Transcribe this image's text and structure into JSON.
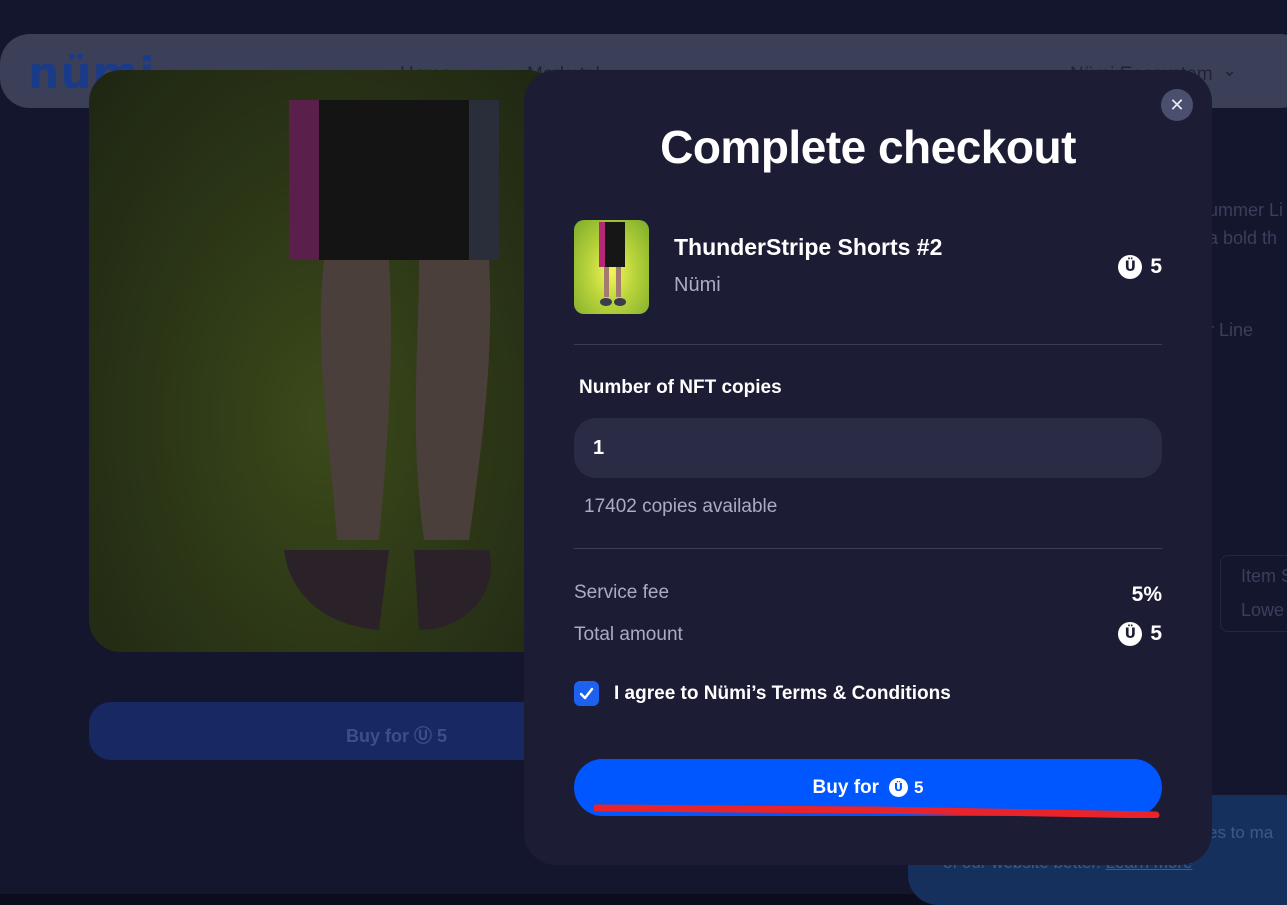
{
  "background": {
    "logo": "nümi",
    "nav": {
      "home": "Home",
      "marketplace": "Marketpl",
      "ecosystem": "Nümi Ecosystem"
    },
    "buy_button": {
      "label": "Buy for",
      "amount": "5"
    },
    "right_text": {
      "line1": "ummer Li",
      "line2": "a bold th",
      "line3": "r Line",
      "card_line1": "Item S",
      "card_line2": "Lowe"
    },
    "cookie": {
      "line1": "es to ma",
      "line2": "of our website better.",
      "link": "Learn more"
    }
  },
  "modal": {
    "title": "Complete checkout",
    "close_icon": "close-icon",
    "item": {
      "name": "ThunderStripe Shorts #2",
      "creator": "Nümi",
      "price": "5",
      "coin_glyph": "Ü"
    },
    "quantity": {
      "label": "Number of NFT copies",
      "value": "1",
      "available": "17402 copies available"
    },
    "service_fee": {
      "label": "Service fee",
      "value": "5%"
    },
    "total": {
      "label": "Total amount",
      "value": "5"
    },
    "terms": {
      "checked": true,
      "label": "I agree to Nümi’s Terms & Conditions"
    },
    "buy_button": {
      "label": "Buy for",
      "amount": "5"
    }
  },
  "colors": {
    "accent": "#0057ff",
    "modal_bg": "#1c1d35",
    "annotation": "#e8232a"
  }
}
